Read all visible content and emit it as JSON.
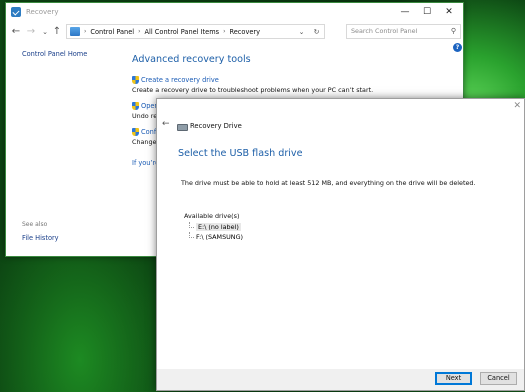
{
  "window": {
    "title": "Recovery",
    "minimize_glyph": "—",
    "maximize_glyph": "☐",
    "close_glyph": "✕"
  },
  "nav": {
    "back_glyph": "←",
    "forward_glyph": "→",
    "dropdown_glyph": "⌄",
    "up_glyph": "↑",
    "breadcrumbs": [
      "Control Panel",
      "All Control Panel Items",
      "Recovery"
    ],
    "separator": "›",
    "refresh_glyph": "↻",
    "search_placeholder": "Search Control Panel",
    "search_glyph": "⚲",
    "help_glyph": "?"
  },
  "sidebar": {
    "home_label": "Control Panel Home",
    "see_also_label": "See also",
    "file_history_label": "File History"
  },
  "main": {
    "heading": "Advanced recovery tools",
    "tools": [
      {
        "label": "Create a recovery drive",
        "desc": "Create a recovery drive to troubleshoot problems when your PC can’t start."
      },
      {
        "label": "Open",
        "desc": "Undo re"
      },
      {
        "label": "Confi",
        "desc": "Change"
      }
    ],
    "if_link": "If you’re"
  },
  "wizard": {
    "close_glyph": "✕",
    "back_glyph": "←",
    "title": "Recovery Drive",
    "heading": "Select the USB flash drive",
    "description": "The drive must be able to hold at least 512 MB, and everything on the drive will be deleted.",
    "available_label": "Available drive(s)",
    "drives": [
      {
        "label": "E:\\ (no label)",
        "selected": true
      },
      {
        "label": "F:\\ (SAMSUNG)",
        "selected": false
      }
    ],
    "next_label": "Next",
    "cancel_label": "Cancel"
  }
}
